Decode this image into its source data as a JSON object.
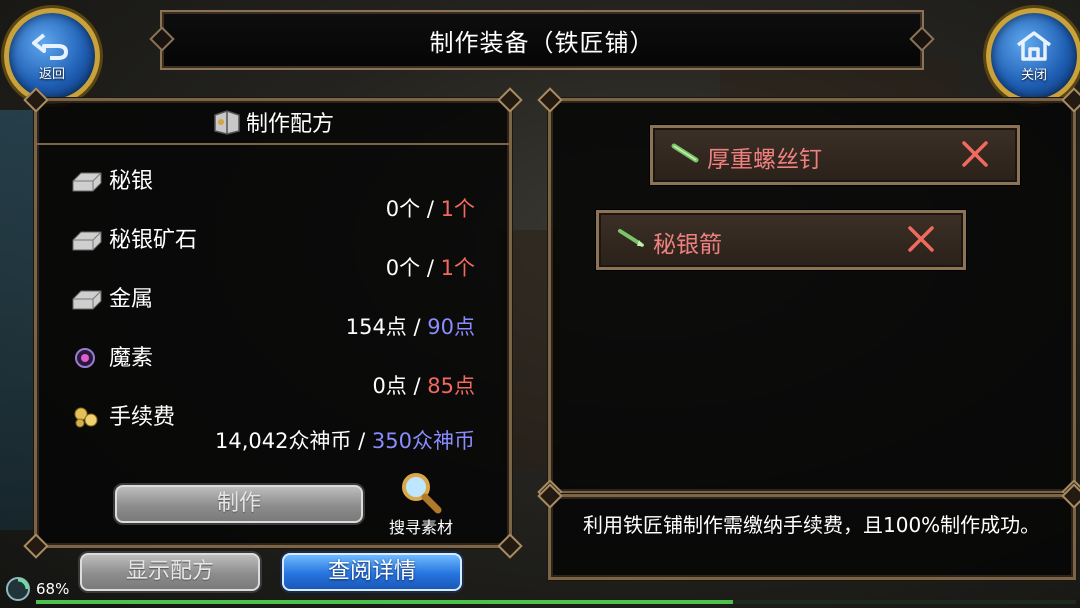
{
  "title": "制作装备（铁匠铺）",
  "top_left_button": {
    "label": "返回",
    "icon": "back-arrow-icon"
  },
  "top_right_button": {
    "label": "关闭",
    "icon": "home-icon"
  },
  "recipe": {
    "header": "制作配方",
    "header_icon": "recipe-book-icon",
    "materials": [
      {
        "name": "秘银",
        "icon": "ingot-icon",
        "have": "0个",
        "separator": "/",
        "need": "1个",
        "need_color": "#f26a5e"
      },
      {
        "name": "秘银矿石",
        "icon": "ingot-icon",
        "have": "0个",
        "separator": "/",
        "need": "1个",
        "need_color": "#f26a5e"
      },
      {
        "name": "金属",
        "icon": "ingot-icon",
        "have": "154点",
        "separator": "/",
        "need": "90点",
        "need_color": "#8a8cff"
      },
      {
        "name": "魔素",
        "icon": "magic-orb-icon",
        "have": "0点",
        "separator": "/",
        "need": "85点",
        "need_color": "#f26a5e"
      },
      {
        "name": "手续费",
        "icon": "coins-icon",
        "have": "14,042众神币",
        "separator": "/",
        "need": "350众神币",
        "need_color": "#8a8cff"
      }
    ],
    "craft_button": "制作",
    "search_label": "搜寻素材"
  },
  "bottom_buttons": {
    "show_recipe": "显示配方",
    "view_details": "查阅详情"
  },
  "slots": [
    {
      "name": "厚重螺丝钉",
      "icon": "bolt-item-icon"
    },
    {
      "name": "秘银箭",
      "icon": "arrow-item-icon"
    }
  ],
  "info": "利用铁匠铺制作需缴纳手续费，且100%制作成功。",
  "status": {
    "percent_text": "68%",
    "xp_progress": 0.67
  },
  "colors": {
    "frame_gold": "#c9a23a",
    "need_short": "#f26a5e",
    "need_met": "#8a8cff",
    "slot_text": "#f08080"
  }
}
